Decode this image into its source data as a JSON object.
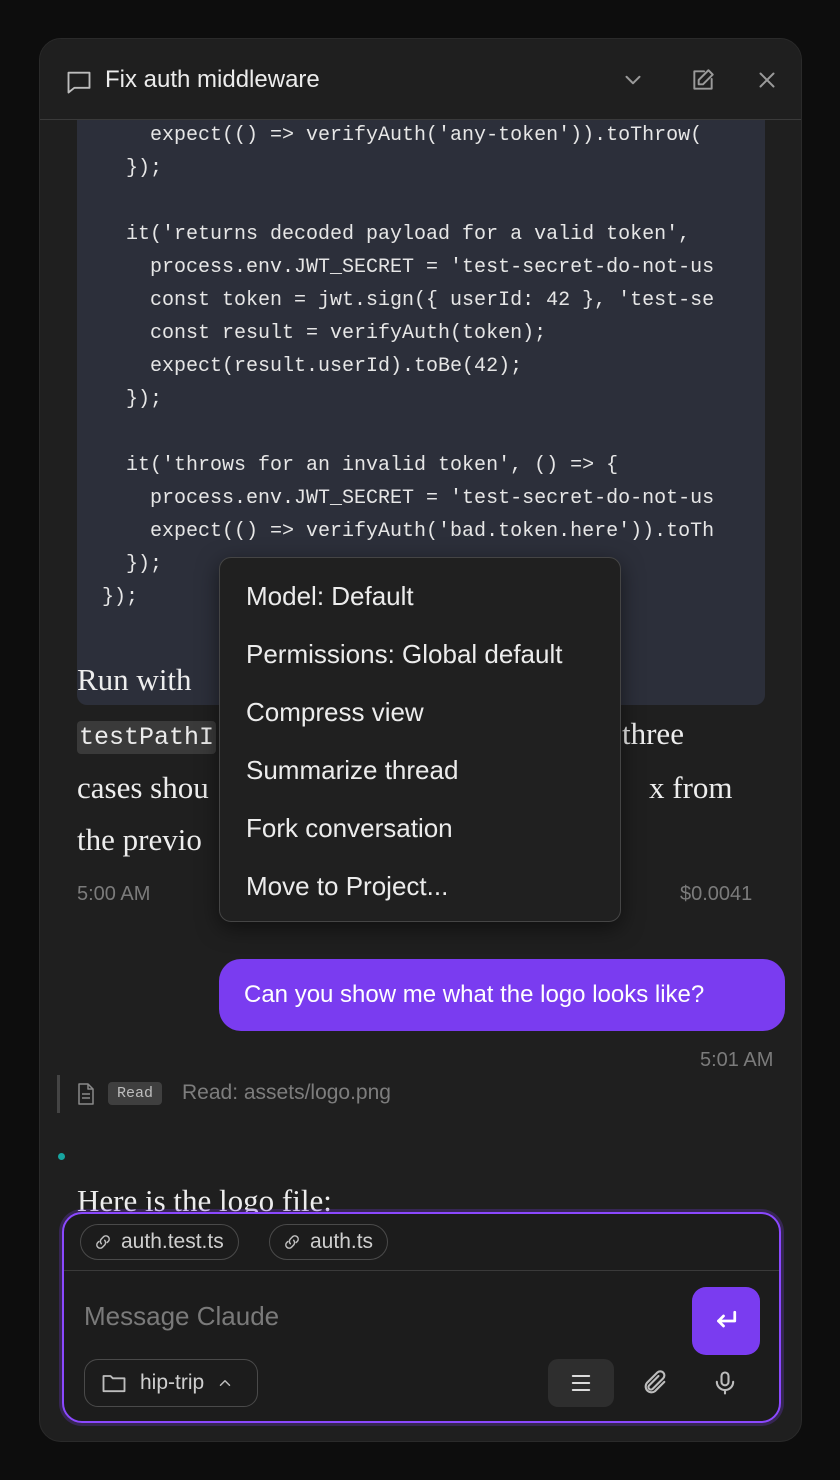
{
  "header": {
    "title": "Fix auth middleware"
  },
  "code": {
    "lines": [
      "    expect(() => verifyAuth('any-token')).toThrow(",
      "  });",
      "",
      "  it('returns decoded payload for a valid token', ",
      "    process.env.JWT_SECRET = 'test-secret-do-not-us",
      "    const token = jwt.sign({ userId: 42 }, 'test-se",
      "    const result = verifyAuth(token);",
      "    expect(result.userId).toBe(42);",
      "  });",
      "",
      "  it('throws for an invalid token', () => {",
      "    process.env.JWT_SECRET = 'test-secret-do-not-us",
      "    expect(() => verifyAuth('bad.token.here')).toTh",
      "  });",
      "});"
    ]
  },
  "assistant_reply_1": {
    "line1": "Run with",
    "line2_code": "testPathI",
    "line2_tail": "three",
    "line3_head": "cases shou",
    "line3_tail": "x from",
    "line4": "the previo",
    "time": "5:00 AM",
    "cost": "$0.0041"
  },
  "menu": {
    "items": [
      "Model: Default",
      "Permissions: Global default",
      "Compress view",
      "Summarize thread",
      "Fork conversation",
      "Move to Project..."
    ]
  },
  "user_message": {
    "text": "Can you show me what the logo looks like?",
    "time": "5:01 AM"
  },
  "tool_call": {
    "badge": "Read",
    "text": "Read: assets/logo.png"
  },
  "assistant_reply_2": {
    "text": "Here is the logo file:"
  },
  "composer": {
    "chips": [
      "auth.test.ts",
      "auth.ts"
    ],
    "placeholder": "Message Claude",
    "folder": "hip-trip"
  },
  "colors": {
    "accent": "#7a3cf0",
    "background": "#1f1f1f",
    "code_bg": "#2c2f3a",
    "status_dot": "#17a5a0"
  }
}
